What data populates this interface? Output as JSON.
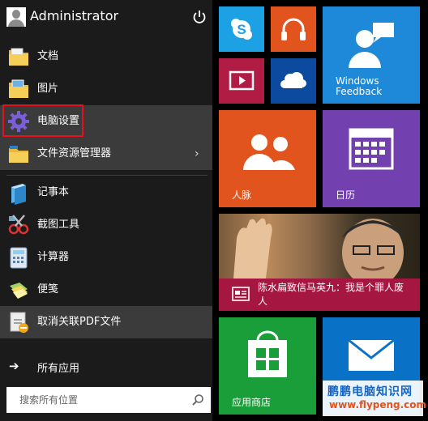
{
  "user": {
    "name": "Administrator"
  },
  "menu": {
    "items": [
      {
        "label": "文档",
        "icon": "folder-documents-icon"
      },
      {
        "label": "图片",
        "icon": "folder-pictures-icon"
      },
      {
        "label": "电脑设置",
        "icon": "gear-icon"
      },
      {
        "label": "文件资源管理器",
        "icon": "file-explorer-icon"
      },
      {
        "label": "记事本",
        "icon": "notepad-icon"
      },
      {
        "label": "截图工具",
        "icon": "snipping-tool-icon"
      },
      {
        "label": "计算器",
        "icon": "calculator-icon"
      },
      {
        "label": "便笺",
        "icon": "sticky-notes-icon"
      },
      {
        "label": "取消关联PDF文件",
        "icon": "unassociate-pdf-icon"
      }
    ],
    "all_apps_label": "所有应用"
  },
  "search": {
    "placeholder": "搜索所有位置"
  },
  "tiles": {
    "feedback": "Windows Feedback",
    "people": "人脉",
    "calendar": "日历",
    "news_headline": "陈水扁致信马英九：我是个罪人废人",
    "store": "应用商店"
  },
  "watermark": {
    "line1": "鹏鹏电脑知识网",
    "line2": "www.flypeng.com"
  },
  "colors": {
    "highlight_border": "#e8101a",
    "skype": "#1da1e5",
    "music": "#e2541d",
    "video": "#b01c43",
    "onedrive": "#0b4a9e",
    "feedback": "#1e88d9",
    "people": "#e2541d",
    "calendar": "#7240af",
    "news": "#a51640",
    "store": "#1a9e3a",
    "mail": "#0a72c6"
  }
}
